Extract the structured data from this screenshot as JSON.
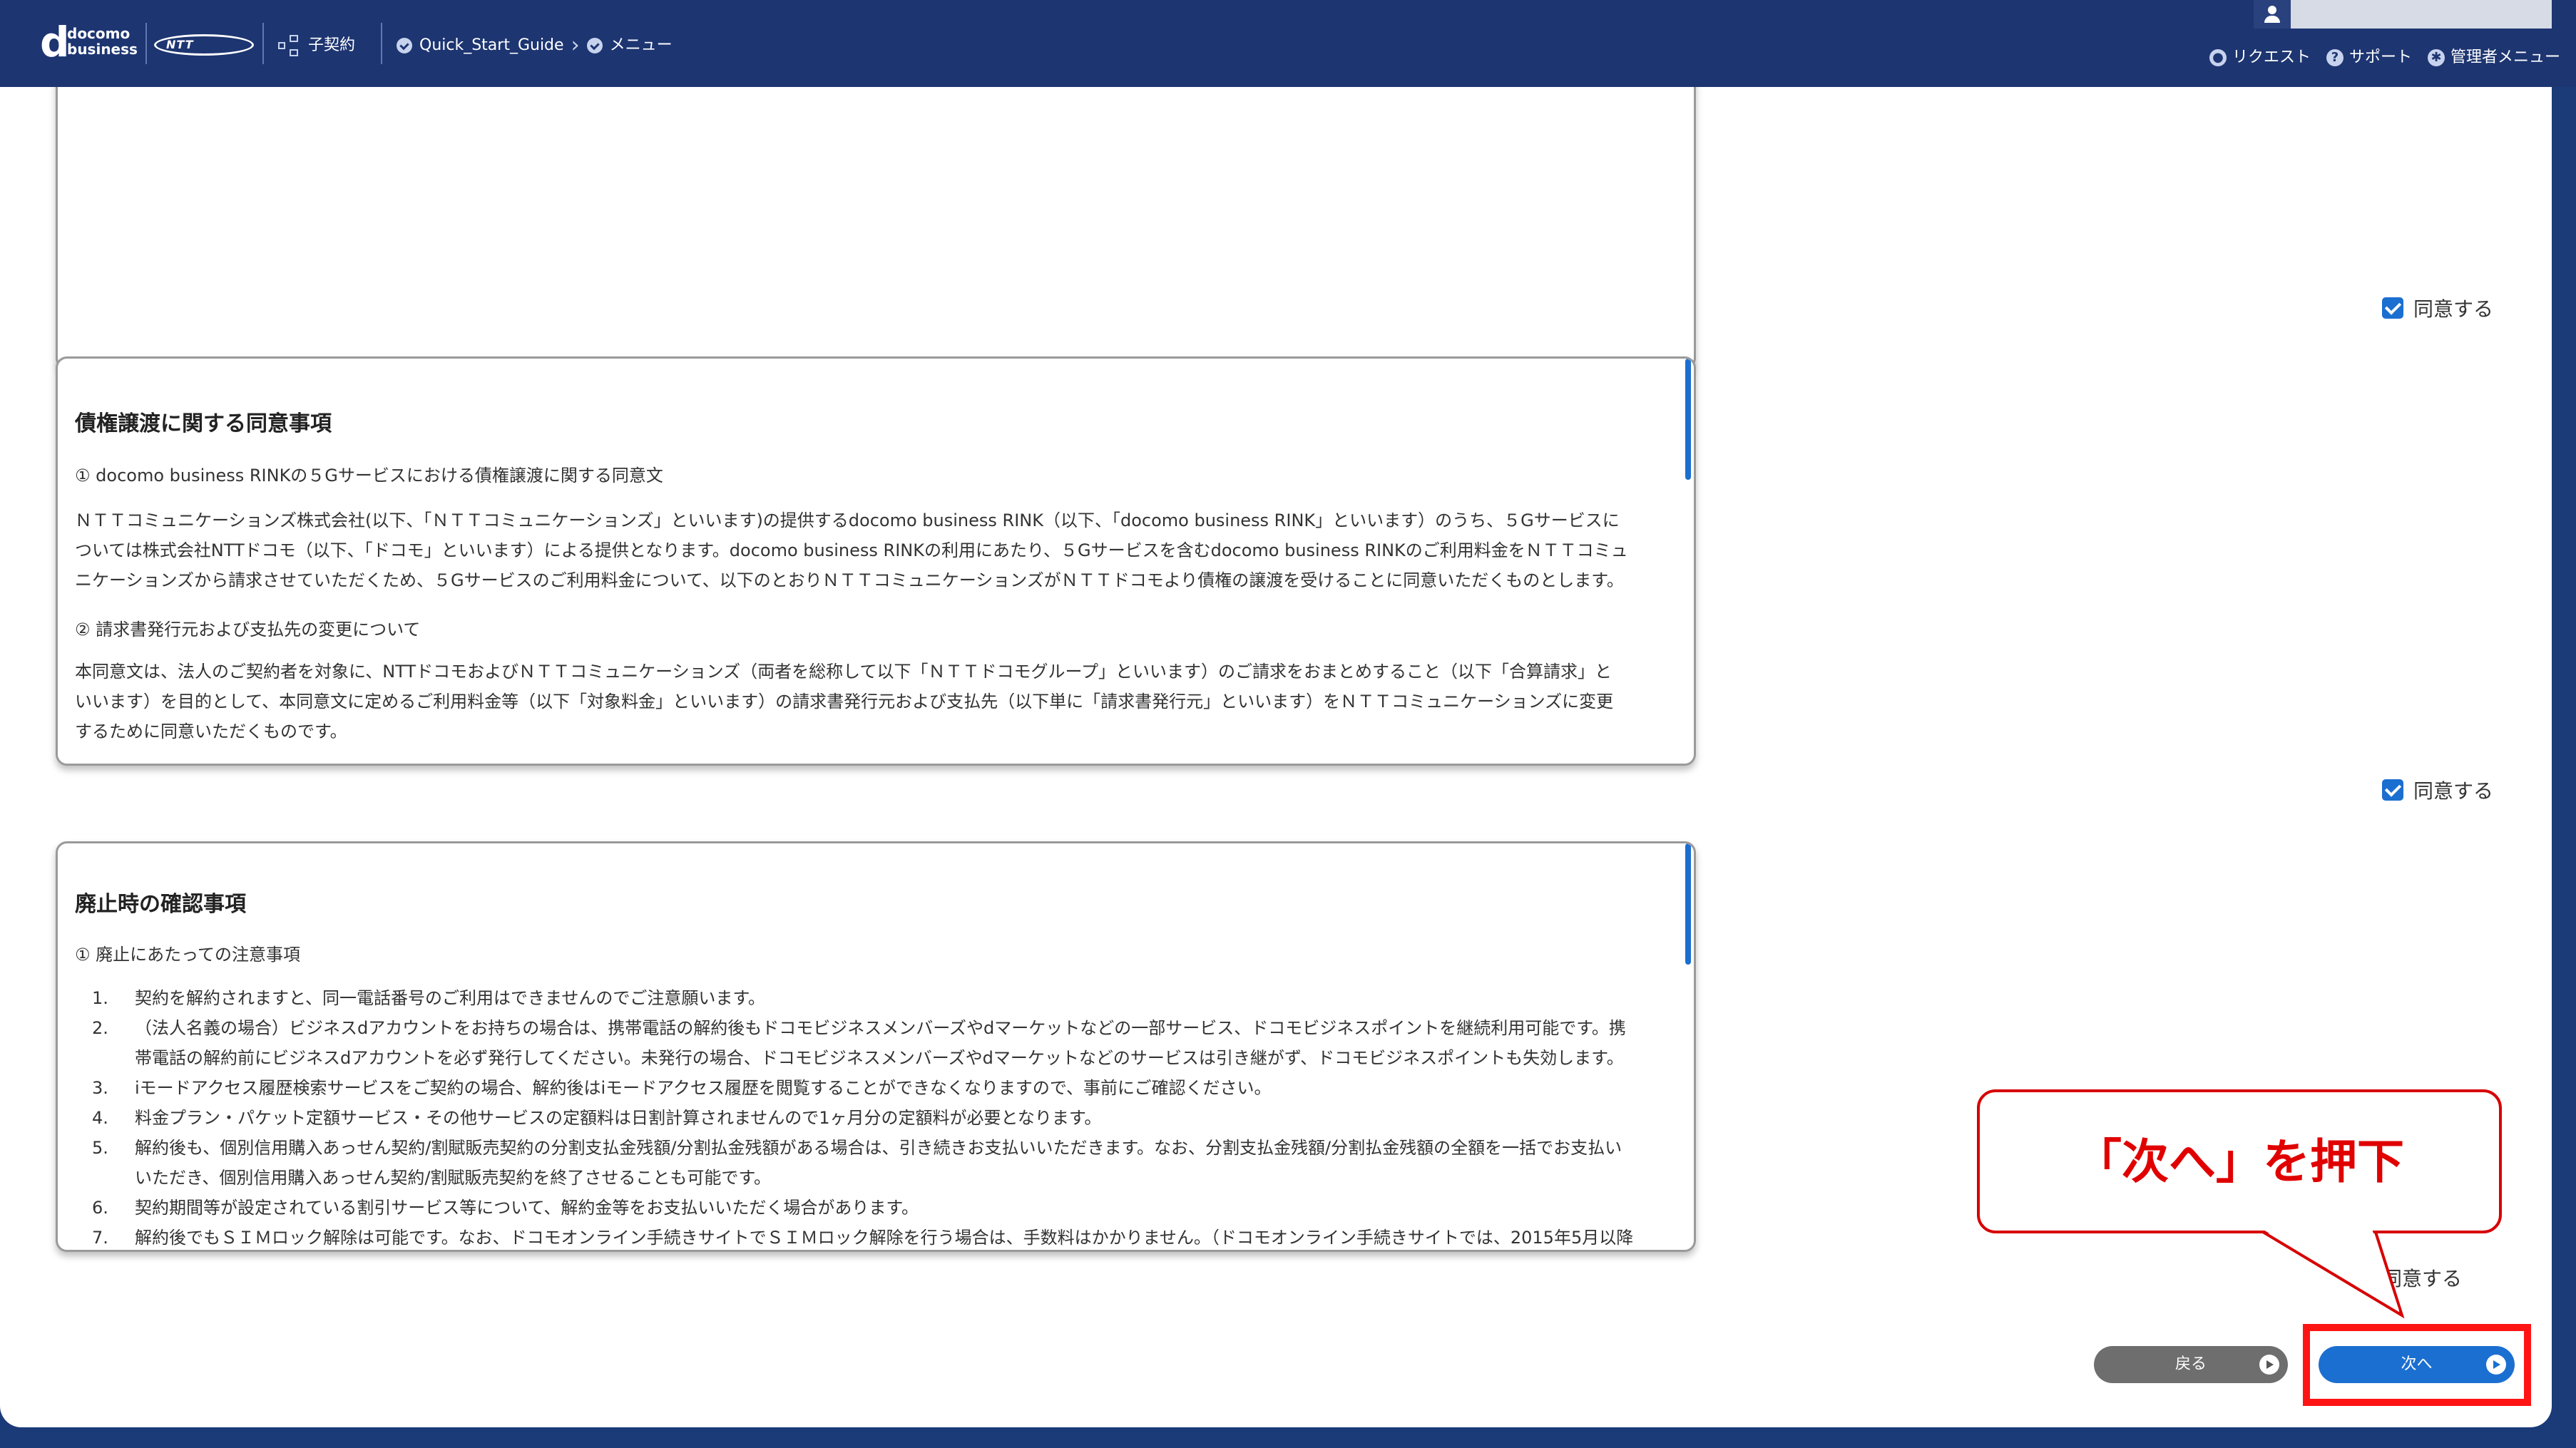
{
  "header": {
    "logo_docomo": "docomo",
    "logo_business": "business",
    "ntt_logo": "NTT",
    "contract_label": "子契約",
    "breadcrumb_1": "Quick_Start_Guide",
    "breadcrumb_2": "メニュー",
    "request_label": "リクエスト",
    "support_label": "サポート",
    "admin_menu_label": "管理者メニュー"
  },
  "agreements": [
    {
      "label": "同意する",
      "checked": true
    },
    {
      "label": "同意する",
      "checked": true
    },
    {
      "label": "同意する",
      "checked": false
    }
  ],
  "panel_debt": {
    "title": "債権譲渡に関する同意事項",
    "section1": "① docomo business RINKの５Gサービスにおける債権譲渡に関する同意文",
    "paragraph1_line1": "ＮＴＴコミュニケーションズ株式会社(以下、「ＮＴＴコミュニケーションズ」といいます)の提供するdocomo business RINK（以下、「docomo business RINK」といいます）のうち、５Gサービスに",
    "paragraph1_line2": "ついては株式会社NTTドコモ（以下、「ドコモ」といいます）による提供となります。docomo business RINKの利用にあたり、５Gサービスを含むdocomo business RINKのご利用料金をＮＴＴコミュ",
    "paragraph1_line3": "ニケーションズから請求させていただくため、５Gサービスのご利用料金について、以下のとおりＮＴＴコミュニケーションズがＮＴＴドコモより債権の譲渡を受けることに同意いただくものとします。",
    "section2": "② 請求書発行元および支払先の変更について",
    "paragraph2_line1": "本同意文は、法人のご契約者を対象に、NTTドコモおよびＮＴＴコミュニケーションズ（両者を総称して以下「ＮＴＴドコモグループ」といいます）のご請求をおまとめすること（以下「合算請求」と",
    "paragraph2_line2": "いいます）を目的として、本同意文に定めるご利用料金等（以下「対象料金」といいます）の請求書発行元および支払先（以下単に「請求書発行元」といいます）をＮＴＴコミュニケーションズに変更",
    "paragraph2_line3": "するために同意いただくものです。"
  },
  "panel_cancel": {
    "title": "廃止時の確認事項",
    "section1": "① 廃止にあたっての注意事項",
    "items": [
      "契約を解約されますと、同一電話番号のご利用はできませんのでご注意願います。",
      "（法人名義の場合）ビジネスdアカウントをお持ちの場合は、携帯電話の解約後もドコモビジネスメンバーズやdマーケットなどの一部サービス、ドコモビジネスポイントを継続利用可能です。携",
      "帯電話の解約前にビジネスdアカウントを必ず発行してください。未発行の場合、ドコモビジネスメンバーズやdマーケットなどのサービスは引き継がず、ドコモビジネスポイントも失効します。",
      "iモードアクセス履歴検索サービスをご契約の場合、解約後はiモードアクセス履歴を閲覧することができなくなりますので、事前にご確認ください。",
      "料金プラン・パケット定額サービス・その他サービスの定額料は日割計算されませんので1ヶ月分の定額料が必要となります。",
      "解約後も、個別信用購入あっせん契約/割賦販売契約の分割支払金残額/分割払金残額がある場合は、引き続きお支払いいただきます。なお、分割支払金残額/分割払金残額の全額を一括でお支払い",
      "いただき、個別信用購入あっせん契約/割賦販売契約を終了させることも可能です。",
      "契約期間等が設定されている割引サービス等について、解約金等をお支払いいただく場合があります。",
      "解約後でもＳＩＭロック解除は可能です。なお、ドコモオンライン手続きサイトでＳＩＭロック解除を行う場合は、手数料はかかりません。（ドコモオンライン手続きサイトでは、2015年5月以降"
    ],
    "item_numbers": [
      "1.",
      "2.",
      "",
      "3.",
      "4.",
      "5.",
      "",
      "6.",
      "7."
    ]
  },
  "buttons": {
    "back": "戻る",
    "next": "次へ"
  },
  "callout": {
    "text": "「次へ」を押下"
  },
  "colors": {
    "header": "#1d3571",
    "accent": "#1b6fd0",
    "highlight": "#ff1414"
  }
}
